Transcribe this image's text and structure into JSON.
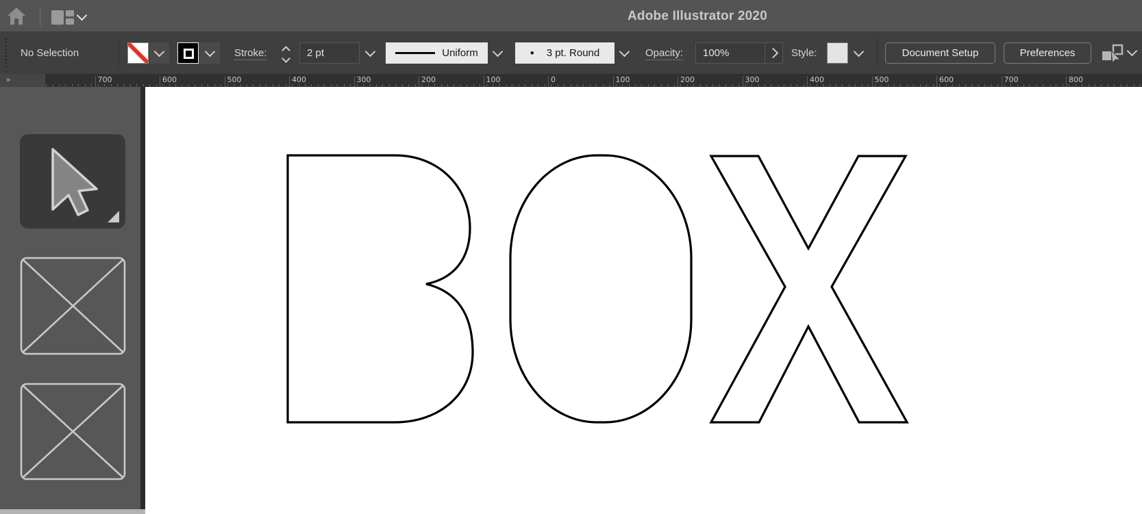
{
  "titlebar": {
    "title": "Adobe Illustrator 2020"
  },
  "controlbar": {
    "selection_status": "No Selection",
    "stroke_label": "Stroke:",
    "stroke_weight_value": "2 pt",
    "variable_width_profile": "Uniform",
    "brush_dot": "•",
    "brush_definition": "3 pt. Round",
    "opacity_label": "Opacity:",
    "opacity_value": "100%",
    "style_label": "Style:",
    "document_setup_label": "Document Setup",
    "preferences_label": "Preferences"
  },
  "ruler": {
    "overflow_indicator": "»",
    "labels": [
      "700",
      "600",
      "500",
      "400",
      "300",
      "200",
      "100",
      "0",
      "100",
      "200",
      "300",
      "400",
      "500",
      "600",
      "700",
      "800"
    ]
  },
  "canvas": {
    "artwork_text": "BOX"
  },
  "colors": {
    "no_fill_red": "#e23424",
    "letter_stroke": "#000000",
    "canvas_bg": "#ffffff",
    "chrome_dark": "#3f3f3f"
  }
}
